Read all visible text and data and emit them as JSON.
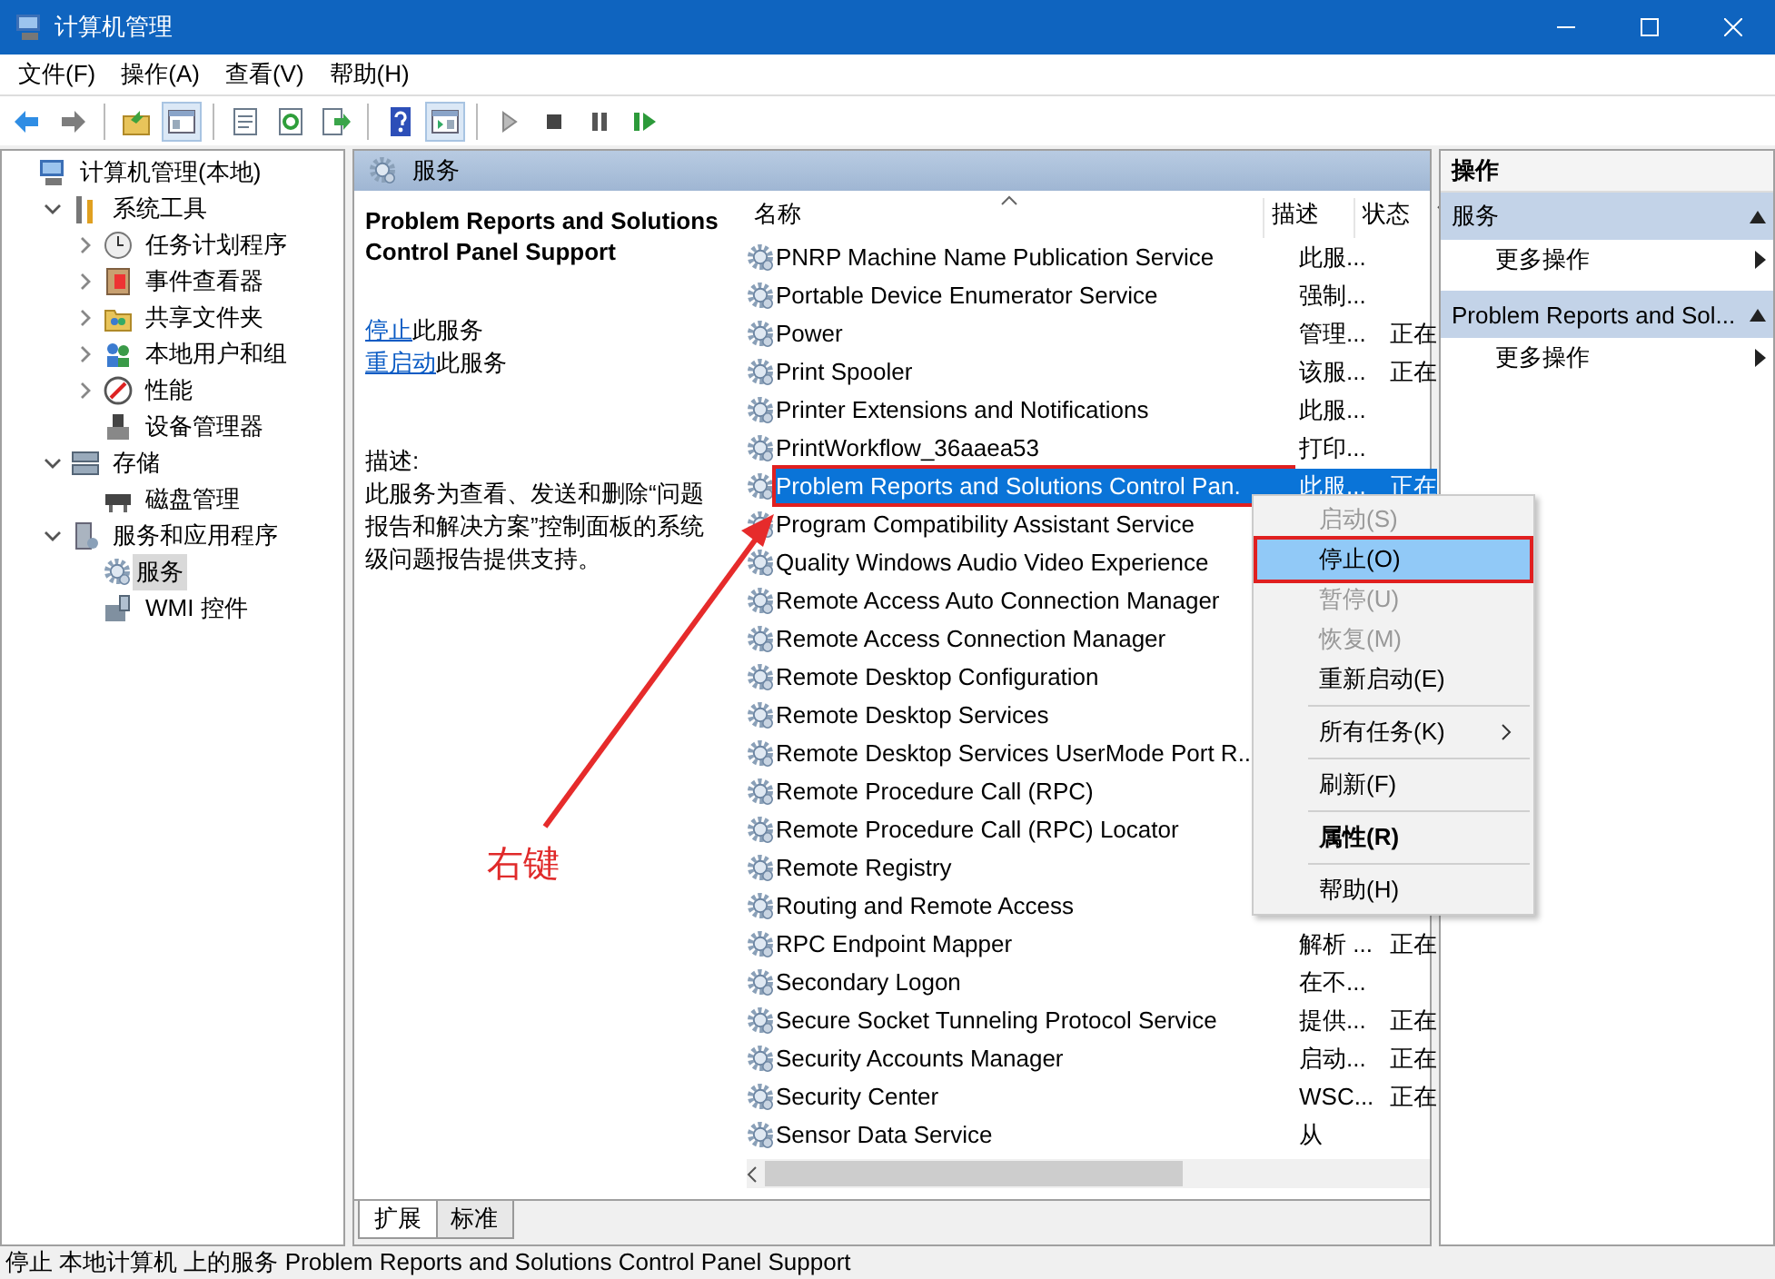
{
  "window": {
    "title": "计算机管理"
  },
  "menu": [
    "文件(F)",
    "操作(A)",
    "查看(V)",
    "帮助(H)"
  ],
  "toolbar": [
    {
      "kind": "back",
      "pressed": false
    },
    {
      "kind": "forward",
      "pressed": false
    },
    {
      "kind": "separator"
    },
    {
      "kind": "up",
      "pressed": false
    },
    {
      "kind": "tree",
      "pressed": true
    },
    {
      "kind": "separator"
    },
    {
      "kind": "properties",
      "pressed": false
    },
    {
      "kind": "refresh",
      "pressed": false
    },
    {
      "kind": "export",
      "pressed": false
    },
    {
      "kind": "separator"
    },
    {
      "kind": "help",
      "pressed": false
    },
    {
      "kind": "actionpane",
      "pressed": true
    },
    {
      "kind": "separator"
    },
    {
      "kind": "play",
      "pressed": false
    },
    {
      "kind": "stop",
      "pressed": false
    },
    {
      "kind": "pause",
      "pressed": false
    },
    {
      "kind": "resume",
      "pressed": false
    }
  ],
  "tree": [
    {
      "label": "计算机管理(本地)",
      "kind": "computer",
      "selected": false,
      "children": [
        {
          "label": "系统工具",
          "kind": "tools",
          "expanded": true,
          "selected": false,
          "children": [
            {
              "label": "任务计划程序",
              "kind": "clock",
              "expanded": false,
              "selected": false
            },
            {
              "label": "事件查看器",
              "kind": "event",
              "expanded": false,
              "selected": false
            },
            {
              "label": "共享文件夹",
              "kind": "folder",
              "expanded": false,
              "selected": false
            },
            {
              "label": "本地用户和组",
              "kind": "users",
              "expanded": false,
              "selected": false
            },
            {
              "label": "性能",
              "kind": "perf",
              "expanded": false,
              "selected": false
            },
            {
              "label": "设备管理器",
              "kind": "device",
              "selected": false
            }
          ]
        },
        {
          "label": "存储",
          "kind": "storage",
          "expanded": true,
          "selected": false,
          "children": [
            {
              "label": "磁盘管理",
              "kind": "disk",
              "selected": false
            }
          ]
        },
        {
          "label": "服务和应用程序",
          "kind": "apps",
          "expanded": true,
          "selected": false,
          "children": [
            {
              "label": "服务",
              "kind": "gear",
              "selected": true
            },
            {
              "label": "WMI 控件",
              "kind": "wmi",
              "selected": false
            }
          ]
        }
      ]
    }
  ],
  "panel_header": "服务",
  "details": {
    "title": "Problem Reports and Solutions Control Panel Support",
    "actions": [
      {
        "link": "停止",
        "text": "此服务"
      },
      {
        "link": "重启动",
        "text": "此服务"
      }
    ],
    "description_label": "描述:",
    "description": "此服务为查看、发送和删除“问题报告和解决方案”控制面板的系统级问题报告提供支持。"
  },
  "list": {
    "columns": [
      "名称",
      "描述",
      "状态"
    ],
    "rows": [
      {
        "name": "PNRP Machine Name Publication Service",
        "description": "此服...",
        "selected": false
      },
      {
        "name": "Portable Device Enumerator Service",
        "description": "强制...",
        "selected": false
      },
      {
        "name": "Power",
        "description": "管理...",
        "status": "正在",
        "selected": false
      },
      {
        "name": "Print Spooler",
        "description": "该服...",
        "status": "正在",
        "selected": false
      },
      {
        "name": "Printer Extensions and Notifications",
        "description": "此服...",
        "selected": false
      },
      {
        "name": "PrintWorkflow_36aaea53",
        "description": "打印...",
        "selected": false
      },
      {
        "name": "Problem Reports and Solutions Control Pan.",
        "description": "此服...",
        "status": "正在",
        "selected": true
      },
      {
        "name": "Program Compatibility Assistant Service",
        "selected": false
      },
      {
        "name": "Quality Windows Audio Video Experience",
        "selected": false
      },
      {
        "name": "Remote Access Auto Connection Manager",
        "selected": false
      },
      {
        "name": "Remote Access Connection Manager",
        "selected": false
      },
      {
        "name": "Remote Desktop Configuration",
        "selected": false
      },
      {
        "name": "Remote Desktop Services",
        "selected": false
      },
      {
        "name": "Remote Desktop Services UserMode Port R..",
        "selected": false
      },
      {
        "name": "Remote Procedure Call (RPC)",
        "selected": false
      },
      {
        "name": "Remote Procedure Call (RPC) Locator",
        "selected": false
      },
      {
        "name": "Remote Registry",
        "selected": false
      },
      {
        "name": "Routing and Remote Access",
        "selected": false
      },
      {
        "name": "RPC Endpoint Mapper",
        "description": "解析 ...",
        "status": "正在",
        "selected": false
      },
      {
        "name": "Secondary Logon",
        "description": "在不...",
        "selected": false
      },
      {
        "name": "Secure Socket Tunneling Protocol Service",
        "description": "提供...",
        "status": "正在",
        "selected": false
      },
      {
        "name": "Security Accounts Manager",
        "description": "启动...",
        "status": "正在",
        "selected": false
      },
      {
        "name": "Security Center",
        "description": "WSC...",
        "status": "正在",
        "selected": false
      },
      {
        "name": "Sensor Data Service",
        "description": "从",
        "selected": false
      }
    ]
  },
  "context_menu": [
    {
      "kind": "item",
      "label": "启动(S)",
      "disabled": true,
      "selected": false
    },
    {
      "kind": "item",
      "label": "停止(O)",
      "disabled": false,
      "selected": true
    },
    {
      "kind": "item",
      "label": "暂停(U)",
      "disabled": true,
      "selected": false
    },
    {
      "kind": "item",
      "label": "恢复(M)",
      "disabled": true,
      "selected": false
    },
    {
      "kind": "item",
      "label": "重新启动(E)",
      "disabled": false,
      "selected": false
    },
    {
      "kind": "separator"
    },
    {
      "kind": "submenu",
      "label": "所有任务(K)",
      "disabled": false,
      "selected": false
    },
    {
      "kind": "separator"
    },
    {
      "kind": "item",
      "label": "刷新(F)",
      "disabled": false,
      "selected": false
    },
    {
      "kind": "separator"
    },
    {
      "kind": "default",
      "label": "属性(R)",
      "disabled": false,
      "selected": false
    },
    {
      "kind": "separator"
    },
    {
      "kind": "item",
      "label": "帮助(H)",
      "disabled": false,
      "selected": false
    }
  ],
  "bottom_tabs": [
    {
      "label": "扩展",
      "selected": true
    },
    {
      "label": "标准",
      "selected": false
    }
  ],
  "actions_pane": {
    "title": "操作",
    "sections": [
      {
        "title": "服务",
        "expanded": true,
        "items": [
          "更多操作"
        ]
      },
      {
        "title": "Problem Reports and Sol...",
        "expanded": true,
        "items": [
          "更多操作"
        ]
      }
    ]
  },
  "status_bar": "停止 本地计算机 上的服务 Problem Reports and Solutions Control Panel Support",
  "annotation": {
    "label": "右键"
  }
}
